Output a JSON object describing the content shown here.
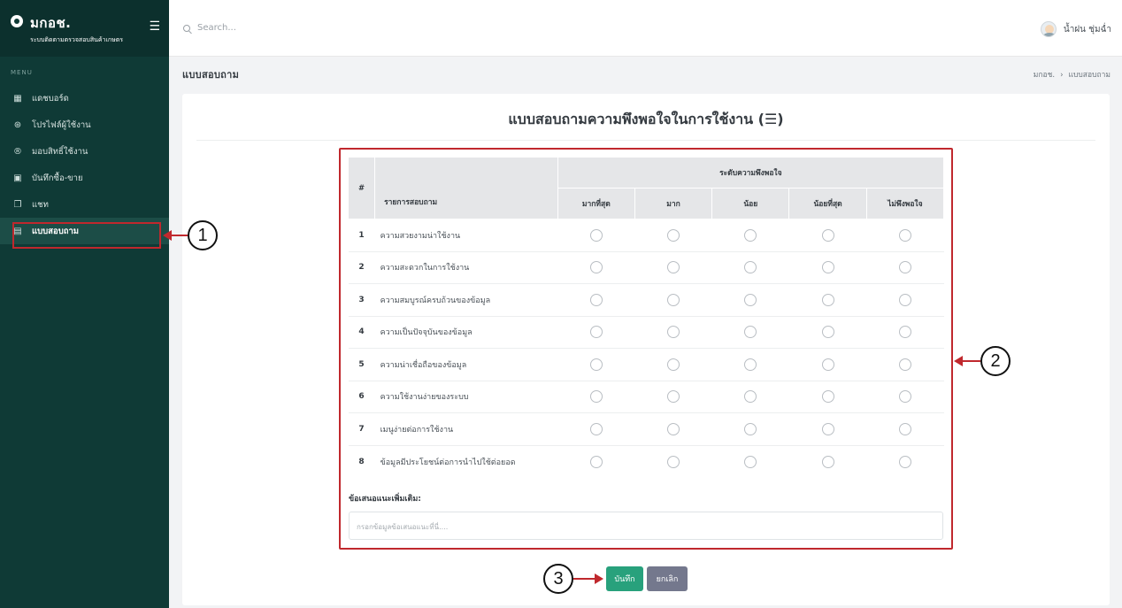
{
  "sidebar": {
    "brand_title": "มกอช.",
    "brand_subtitle": "ระบบติดตามตรวจสอบสินค้าเกษตร",
    "menu_label": "MENU",
    "items": [
      {
        "label": "แดชบอร์ด",
        "icon": "dashboard-icon",
        "glyph": "▦"
      },
      {
        "label": "โปรไฟล์ผู้ใช้งาน",
        "icon": "profile-icon",
        "glyph": "⊛"
      },
      {
        "label": "มอบสิทธิ์ใช้งาน",
        "icon": "registered-icon",
        "glyph": "®"
      },
      {
        "label": "บันทึกซื้อ-ขาย",
        "icon": "save-icon",
        "glyph": "▣"
      },
      {
        "label": "แชท",
        "icon": "chat-icon",
        "glyph": "❐"
      },
      {
        "label": "แบบสอบถาม",
        "icon": "survey-icon",
        "glyph": "▤",
        "active": true
      }
    ]
  },
  "topbar": {
    "search_placeholder": "Search...",
    "user_name": "น้ำฝน ชุ่มฉ่ำ"
  },
  "page": {
    "title": "แบบสอบถาม",
    "breadcrumb": [
      "มกอช.",
      "แบบสอบถาม"
    ]
  },
  "survey": {
    "title": "แบบสอบถามความพึงพอใจในการใช้งาน (☰)",
    "group_header": "ระดับความพึงพอใจ",
    "col_num": "#",
    "col_item": "รายการสอบถาม",
    "options": [
      "มากที่สุด",
      "มาก",
      "น้อย",
      "น้อยที่สุด",
      "ไม่พึงพอใจ"
    ],
    "rows": [
      {
        "num": "1",
        "item": "ความสวยงามน่าใช้งาน"
      },
      {
        "num": "2",
        "item": "ความสะดวกในการใช้งาน"
      },
      {
        "num": "3",
        "item": "ความสมบูรณ์ครบถ้วนของข้อมูล"
      },
      {
        "num": "4",
        "item": "ความเป็นปัจจุบันของข้อมูล"
      },
      {
        "num": "5",
        "item": "ความน่าเชื่อถือของข้อมูล"
      },
      {
        "num": "6",
        "item": "ความใช้งานง่ายของระบบ"
      },
      {
        "num": "7",
        "item": "เมนูง่ายต่อการใช้งาน"
      },
      {
        "num": "8",
        "item": "ข้อมูลมีประโยชน์ต่อการนำไปใช้ต่อยอด"
      }
    ],
    "extra_label": "ข้อเสนอแนะเพิ่มเติม:",
    "extra_placeholder": "กรอกข้อมูลข้อเสนอแนะที่นี่....",
    "save_label": "บันทึก",
    "cancel_label": "ยกเลิก"
  },
  "annotations": {
    "marker_1": "1",
    "marker_2": "2",
    "marker_3": "3",
    "accent_color": "#c0282d"
  }
}
